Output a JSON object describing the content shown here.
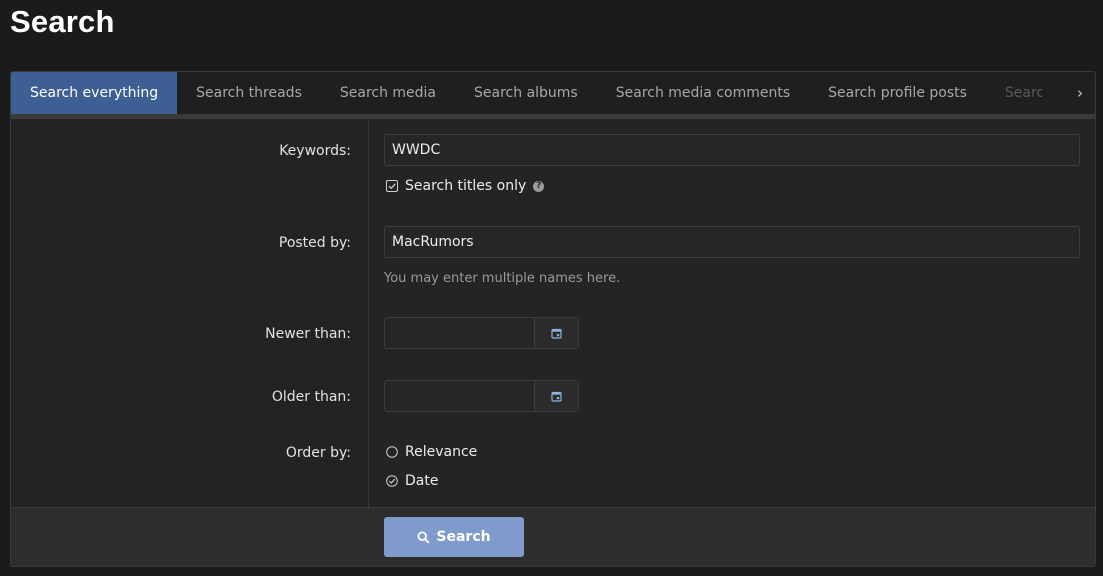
{
  "page": {
    "title": "Search"
  },
  "tabs": [
    {
      "label": "Search everything",
      "active": true
    },
    {
      "label": "Search threads"
    },
    {
      "label": "Search media"
    },
    {
      "label": "Search albums"
    },
    {
      "label": "Search media comments"
    },
    {
      "label": "Search profile posts"
    },
    {
      "label": "Search"
    }
  ],
  "form": {
    "keywords": {
      "label": "Keywords:",
      "value": "WWDC",
      "titles_only_label": "Search titles only",
      "titles_only_checked": true
    },
    "posted_by": {
      "label": "Posted by:",
      "value": "MacRumors",
      "hint": "You may enter multiple names here."
    },
    "newer_than": {
      "label": "Newer than:",
      "value": ""
    },
    "older_than": {
      "label": "Older than:",
      "value": ""
    },
    "order_by": {
      "label": "Order by:",
      "options": [
        "Relevance",
        "Date"
      ],
      "selected": "Date"
    }
  },
  "footer": {
    "submit_label": "Search"
  },
  "icons": {
    "tab_scroll": "chevron-right-icon",
    "calendar": "calendar-icon",
    "submit": "search-icon",
    "help": "question-icon"
  },
  "colors": {
    "accent": "#3e5f94",
    "button": "#7e9bcb",
    "background": "#1b1b1b"
  }
}
